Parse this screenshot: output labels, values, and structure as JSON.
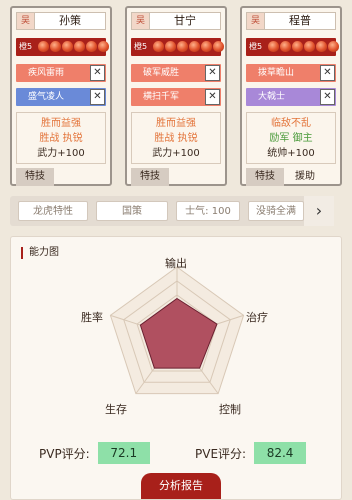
{
  "heroes": [
    {
      "faction": "吴",
      "name": "孙策",
      "rank": "橙5",
      "skills": [
        "疾风雷雨",
        "盛气凌人"
      ],
      "traits": [
        "胜而益强",
        "胜战 执锐",
        "武力+100"
      ],
      "tabs": [
        "特技",
        ""
      ]
    },
    {
      "faction": "吴",
      "name": "甘宁",
      "rank": "橙5",
      "skills": [
        "破军威胜",
        "横扫千军"
      ],
      "traits": [
        "胜而益强",
        "胜战 执锐",
        "武力+100"
      ],
      "tabs": [
        "特技",
        ""
      ]
    },
    {
      "faction": "吴",
      "name": "程普",
      "rank": "橙5",
      "skills": [
        "拨草瞻山",
        "大戟士"
      ],
      "traits": [
        "临敌不乱",
        "励军 御主",
        "统帅+100"
      ],
      "tabs": [
        "特技",
        "援助"
      ]
    }
  ],
  "filters": [
    "龙虎特性",
    "国策",
    "士气: 100",
    "没骑全满"
  ],
  "panel": {
    "title": "能力图",
    "axes": [
      "输出",
      "治疗",
      "控制",
      "生存",
      "胜率"
    ],
    "pvp_label": "PVP评分:",
    "pvp_value": "72.1",
    "pve_label": "PVE评分:",
    "pve_value": "82.4",
    "report_button": "分析报告",
    "radar_levels": [
      0.55,
      0.6,
      0.55,
      0.55,
      0.55
    ]
  },
  "colors": {
    "accent": "#a8201a",
    "radar_fill": "#b05060",
    "score_bg": "#8ee0a8"
  }
}
